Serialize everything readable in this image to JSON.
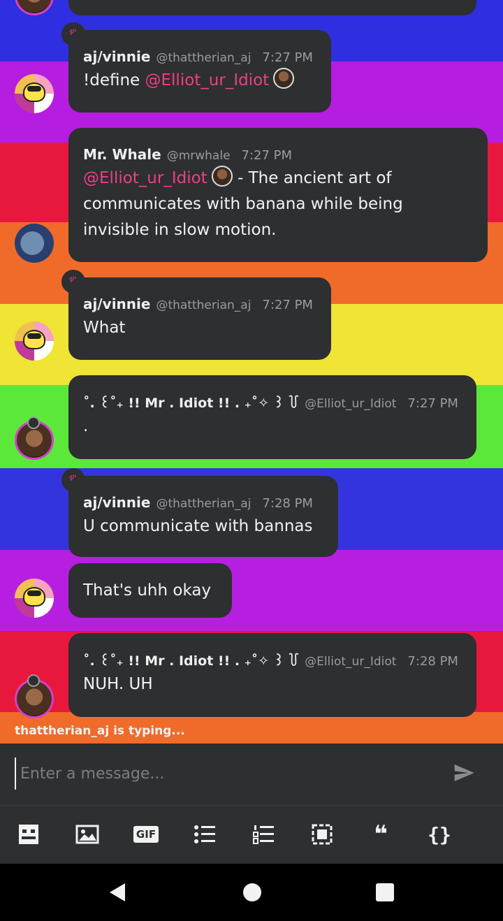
{
  "messages": [
    {
      "name": "aj/vinnie",
      "handle": "@thattherian_aj",
      "time": "7:27 PM",
      "text_prefix": "!define ",
      "mention": "@Elliot_ur_Idiot"
    },
    {
      "name": "Mr. Whale",
      "handle": "@mrwhale",
      "time": "7:27 PM",
      "mention": "@Elliot_ur_Idiot",
      "text": " - The ancient art of communicates with banana while being invisible in slow motion."
    },
    {
      "name": "aj/vinnie",
      "handle": "@thattherian_aj",
      "time": "7:27 PM",
      "text": "What"
    },
    {
      "name": "˚. ꒰˚₊ !! Mr . Idiot !! . ₊˚✧ ꒱ ꒦",
      "handle": "@Elliot_ur_Idiot",
      "time": "7:27 PM",
      "text": "."
    },
    {
      "name": "aj/vinnie",
      "handle": "@thattherian_aj",
      "time": "7:28 PM",
      "text": "U communicate with bannas"
    },
    {
      "text": "That's uhh okay"
    },
    {
      "name": "˚. ꒰˚₊ !! Mr . Idiot !! . ₊˚✧ ꒱ ꒦",
      "handle": "@Elliot_ur_Idiot",
      "time": "7:28 PM",
      "text": "NUH. UH"
    }
  ],
  "typing": "thattherian_aj is typing...",
  "composer": {
    "placeholder": "Enter a message..."
  },
  "toolbar": {
    "icons": [
      "emoji-icon",
      "image-icon",
      "gif-icon",
      "bullet-list-icon",
      "numbered-list-icon",
      "select-icon",
      "quote-icon",
      "code-icon"
    ],
    "gif_label": "GIF",
    "quote_glyph": "❝",
    "code_glyph": "{}"
  },
  "colors": {
    "accent": "#ee3f86",
    "bubble": "#2d2f31"
  }
}
